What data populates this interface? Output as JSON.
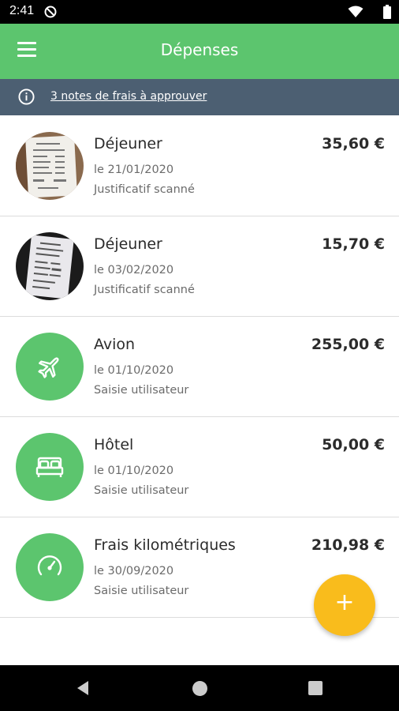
{
  "status_bar": {
    "time": "2:41"
  },
  "app_bar": {
    "title": "Dépenses",
    "menu_icon": "hamburger-menu-icon"
  },
  "banner": {
    "icon": "info-icon",
    "link_text": "3 notes de frais à approuver"
  },
  "expenses": [
    {
      "title": "Déjeuner",
      "date": "le 21/01/2020",
      "source": "Justificatif scanné",
      "amount": "35,60 €",
      "avatar": "receipt-photo"
    },
    {
      "title": "Déjeuner",
      "date": "le 03/02/2020",
      "source": "Justificatif scanné",
      "amount": "15,70 €",
      "avatar": "receipt-photo"
    },
    {
      "title": "Avion",
      "date": "le 01/10/2020",
      "source": "Saisie utilisateur",
      "amount": "255,00 €",
      "avatar": "airplane-icon"
    },
    {
      "title": "Hôtel",
      "date": "le 01/10/2020",
      "source": "Saisie utilisateur",
      "amount": "50,00 €",
      "avatar": "bed-icon"
    },
    {
      "title": "Frais kilométriques",
      "date": "le 30/09/2020",
      "source": "Saisie utilisateur",
      "amount": "210,98 €",
      "avatar": "speedometer-icon"
    }
  ],
  "fab": {
    "label": "+",
    "icon": "add-icon"
  },
  "colors": {
    "app_bar": "#5cc56e",
    "banner": "#4c5f72",
    "fab": "#f9bc1c",
    "category_avatar": "#5cc56e"
  }
}
